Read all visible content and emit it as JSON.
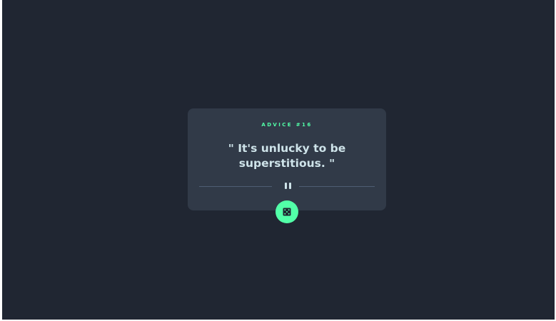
{
  "card": {
    "advice_label": "ADVICE #16",
    "quote": "\" It's unlucky to be superstitious. \""
  },
  "icons": {
    "divider": "pause-icon",
    "button": "dice-icon"
  },
  "colors": {
    "background": "#202632",
    "card": "#313a48",
    "accent": "#52ffa8",
    "text": "#cee3e9",
    "divider": "#4f5d74"
  }
}
